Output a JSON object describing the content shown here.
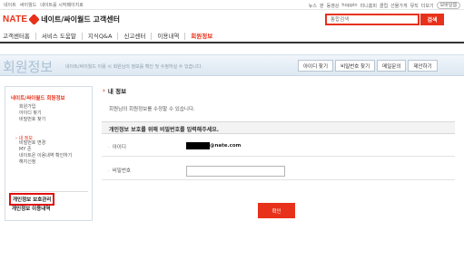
{
  "topbar": {
    "left_links": [
      "네이트",
      "싸이월드",
      "네이트를 시작페이지로"
    ],
    "right_links": [
      "뉴스",
      "판",
      "동영상",
      "hoppin",
      "미니홈피",
      "클럽",
      "선물가게",
      "뮤직",
      "더보기"
    ],
    "mobile_label": "모바일웹"
  },
  "header": {
    "brand": "NATE",
    "service_title": "네이트/싸이월드 고객센터",
    "search_placeholder": "통합검색",
    "search_button": "검색"
  },
  "nav": {
    "items": [
      "고객센터홈",
      "서비스 도움말",
      "지식Q&A",
      "신고센터",
      "이용내역",
      "회원정보"
    ],
    "active": "회원정보"
  },
  "banner": {
    "title": "회원정보",
    "description": "네이트/싸이월드 이용 시 회원님의 정보를 확인 및 수정하실 수 있습니다.",
    "buttons": [
      "아이디 찾기",
      "비밀번호 찾기",
      "메일문의",
      "제안하기"
    ]
  },
  "sidebar": {
    "section_title": "네이트/싸이월드 회원정보",
    "links": [
      "회원가입",
      "아이디 찾기",
      "비밀번호 찾기"
    ],
    "sub_title": "› 내 정보",
    "sub_links": [
      "비밀번호 변경",
      "MY 존",
      "네이트온 이용내역 확인하기",
      "해지신청"
    ],
    "privacy_manage": "개인정보 보호관리",
    "privacy_history": "개인정보 이용내역"
  },
  "main": {
    "title": "내 정보",
    "description": "회원님의 회원정보를 수정할 수 있습니다.",
    "notice": "개인정보 보호를 위해 비밀번호를 입력해주세요.",
    "id_label": "아이디",
    "id_domain": "@nate.com",
    "password_label": "비밀번호",
    "confirm_button": "확인"
  }
}
